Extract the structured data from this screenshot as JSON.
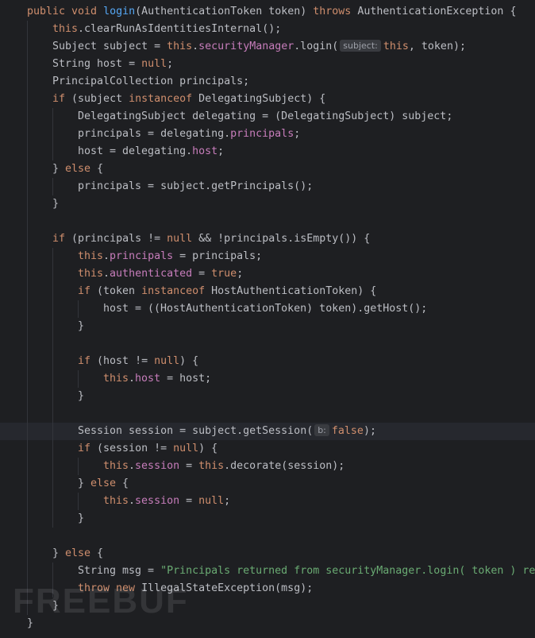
{
  "colors": {
    "background": "#1e1f22",
    "text": "#bcbec4",
    "keyword": "#cf8e6d",
    "function": "#56a8f5",
    "field": "#c77dbb",
    "string": "#6aab73",
    "hint_bg": "#393b40",
    "current_line": "#26282e"
  },
  "editor": {
    "lines": [
      {
        "indent": 0,
        "tokens": [
          [
            "kw",
            "public void "
          ],
          [
            "fn",
            "login"
          ],
          [
            "",
            "(AuthenticationToken token) "
          ],
          [
            "kw",
            "throws "
          ],
          [
            "",
            "AuthenticationException {"
          ]
        ]
      },
      {
        "indent": 1,
        "tokens": [
          [
            "kw",
            "this"
          ],
          [
            "",
            ".clearRunAsIdentitiesInternal();"
          ]
        ]
      },
      {
        "indent": 1,
        "tokens": [
          [
            "",
            "Subject subject = "
          ],
          [
            "kw",
            "this"
          ],
          [
            "",
            "."
          ],
          [
            "fld",
            "securityManager"
          ],
          [
            "",
            ".login("
          ],
          [
            "hint",
            "subject:"
          ],
          [
            "kw",
            "this"
          ],
          [
            "",
            ", token);"
          ]
        ]
      },
      {
        "indent": 1,
        "tokens": [
          [
            "",
            "String host = "
          ],
          [
            "kw",
            "null"
          ],
          [
            "",
            ";"
          ]
        ]
      },
      {
        "indent": 1,
        "tokens": [
          [
            "",
            "PrincipalCollection principals;"
          ]
        ]
      },
      {
        "indent": 1,
        "tokens": [
          [
            "kw",
            "if "
          ],
          [
            "",
            "(subject "
          ],
          [
            "kw",
            "instanceof "
          ],
          [
            "",
            "DelegatingSubject) {"
          ]
        ]
      },
      {
        "indent": 2,
        "tokens": [
          [
            "",
            "DelegatingSubject delegating = (DelegatingSubject) subject;"
          ]
        ]
      },
      {
        "indent": 2,
        "tokens": [
          [
            "",
            "principals = delegating."
          ],
          [
            "fld",
            "principals"
          ],
          [
            "",
            ";"
          ]
        ]
      },
      {
        "indent": 2,
        "tokens": [
          [
            "",
            "host = delegating."
          ],
          [
            "fld",
            "host"
          ],
          [
            "",
            ";"
          ]
        ]
      },
      {
        "indent": 1,
        "tokens": [
          [
            "",
            "} "
          ],
          [
            "kw",
            "else "
          ],
          [
            "",
            "{"
          ]
        ]
      },
      {
        "indent": 2,
        "tokens": [
          [
            "",
            "principals = subject.getPrincipals();"
          ]
        ]
      },
      {
        "indent": 1,
        "tokens": [
          [
            "",
            "}"
          ]
        ]
      },
      {
        "indent": 1,
        "tokens": []
      },
      {
        "indent": 1,
        "tokens": [
          [
            "kw",
            "if "
          ],
          [
            "",
            "(principals != "
          ],
          [
            "kw",
            "null "
          ],
          [
            "",
            "&& !principals.isEmpty()) {"
          ]
        ]
      },
      {
        "indent": 2,
        "tokens": [
          [
            "kw",
            "this"
          ],
          [
            "",
            "."
          ],
          [
            "fld",
            "principals"
          ],
          [
            "",
            " = principals;"
          ]
        ]
      },
      {
        "indent": 2,
        "tokens": [
          [
            "kw",
            "this"
          ],
          [
            "",
            "."
          ],
          [
            "fld",
            "authenticated"
          ],
          [
            "",
            " = "
          ],
          [
            "kw",
            "true"
          ],
          [
            "",
            ";"
          ]
        ]
      },
      {
        "indent": 2,
        "tokens": [
          [
            "kw",
            "if "
          ],
          [
            "",
            "(token "
          ],
          [
            "kw",
            "instanceof "
          ],
          [
            "",
            "HostAuthenticationToken) {"
          ]
        ]
      },
      {
        "indent": 3,
        "tokens": [
          [
            "",
            "host = ((HostAuthenticationToken) token).getHost();"
          ]
        ]
      },
      {
        "indent": 2,
        "tokens": [
          [
            "",
            "}"
          ]
        ]
      },
      {
        "indent": 2,
        "tokens": []
      },
      {
        "indent": 2,
        "tokens": [
          [
            "kw",
            "if "
          ],
          [
            "",
            "(host != "
          ],
          [
            "kw",
            "null"
          ],
          [
            "",
            ") {"
          ]
        ]
      },
      {
        "indent": 3,
        "tokens": [
          [
            "kw",
            "this"
          ],
          [
            "",
            "."
          ],
          [
            "fld",
            "host"
          ],
          [
            "",
            " = host;"
          ]
        ]
      },
      {
        "indent": 2,
        "tokens": [
          [
            "",
            "}"
          ]
        ]
      },
      {
        "indent": 2,
        "tokens": []
      },
      {
        "indent": 2,
        "current": true,
        "tokens": [
          [
            "",
            "Session session = subject.getSession("
          ],
          [
            "hint",
            "b:"
          ],
          [
            "kw",
            "false"
          ],
          [
            "",
            ");"
          ]
        ]
      },
      {
        "indent": 2,
        "tokens": [
          [
            "kw",
            "if "
          ],
          [
            "",
            "(session != "
          ],
          [
            "kw",
            "null"
          ],
          [
            "",
            ") {"
          ]
        ]
      },
      {
        "indent": 3,
        "tokens": [
          [
            "kw",
            "this"
          ],
          [
            "",
            "."
          ],
          [
            "fld",
            "session"
          ],
          [
            "",
            " = "
          ],
          [
            "kw",
            "this"
          ],
          [
            "",
            ".decorate(session);"
          ]
        ]
      },
      {
        "indent": 2,
        "tokens": [
          [
            "",
            "} "
          ],
          [
            "kw",
            "else "
          ],
          [
            "",
            "{"
          ]
        ]
      },
      {
        "indent": 3,
        "tokens": [
          [
            "kw",
            "this"
          ],
          [
            "",
            "."
          ],
          [
            "fld",
            "session"
          ],
          [
            "",
            " = "
          ],
          [
            "kw",
            "null"
          ],
          [
            "",
            ";"
          ]
        ]
      },
      {
        "indent": 2,
        "tokens": [
          [
            "",
            "}"
          ]
        ]
      },
      {
        "indent": 1,
        "tokens": []
      },
      {
        "indent": 1,
        "tokens": [
          [
            "",
            "} "
          ],
          [
            "kw",
            "else "
          ],
          [
            "",
            "{"
          ]
        ]
      },
      {
        "indent": 2,
        "tokens": [
          [
            "",
            "String msg = "
          ],
          [
            "str",
            "\"Principals returned from securityManager.login( token ) re"
          ]
        ]
      },
      {
        "indent": 2,
        "tokens": [
          [
            "kw",
            "throw new "
          ],
          [
            "",
            "IllegalStateException(msg);"
          ]
        ]
      },
      {
        "indent": 1,
        "tokens": [
          [
            "",
            "}"
          ]
        ]
      },
      {
        "indent": 0,
        "tokens": [
          [
            "",
            "}"
          ]
        ]
      }
    ]
  },
  "watermark": {
    "text": "FREEBUF"
  }
}
